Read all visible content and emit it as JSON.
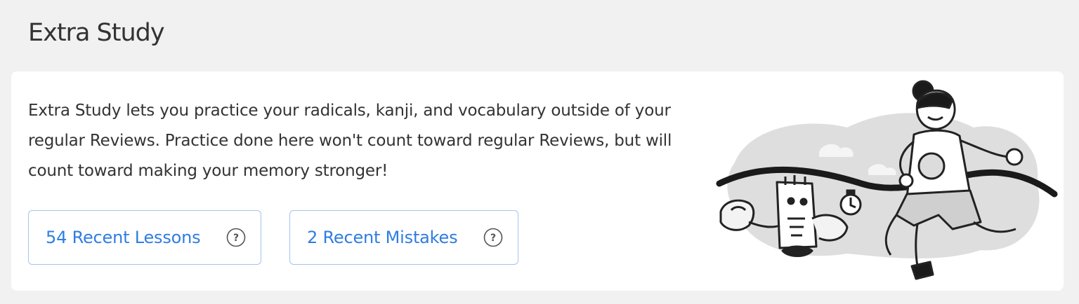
{
  "section": {
    "title": "Extra Study"
  },
  "card": {
    "description": "Extra Study lets you practice your radicals, kanji, and vocabulary outside of your regular Reviews. Practice done here won't count toward regular Reviews, but will count toward making your memory stronger!",
    "buttons": [
      {
        "label": "54 Recent Lessons",
        "icon": "help-icon"
      },
      {
        "label": "2 Recent Mistakes",
        "icon": "help-icon"
      }
    ],
    "illustration": "finish-line-runner-illustration"
  },
  "colors": {
    "page_background": "#f1f1f1",
    "card_background": "#ffffff",
    "button_text": "#2f7de1",
    "button_border": "#a4c4f0",
    "body_text": "#333333"
  }
}
